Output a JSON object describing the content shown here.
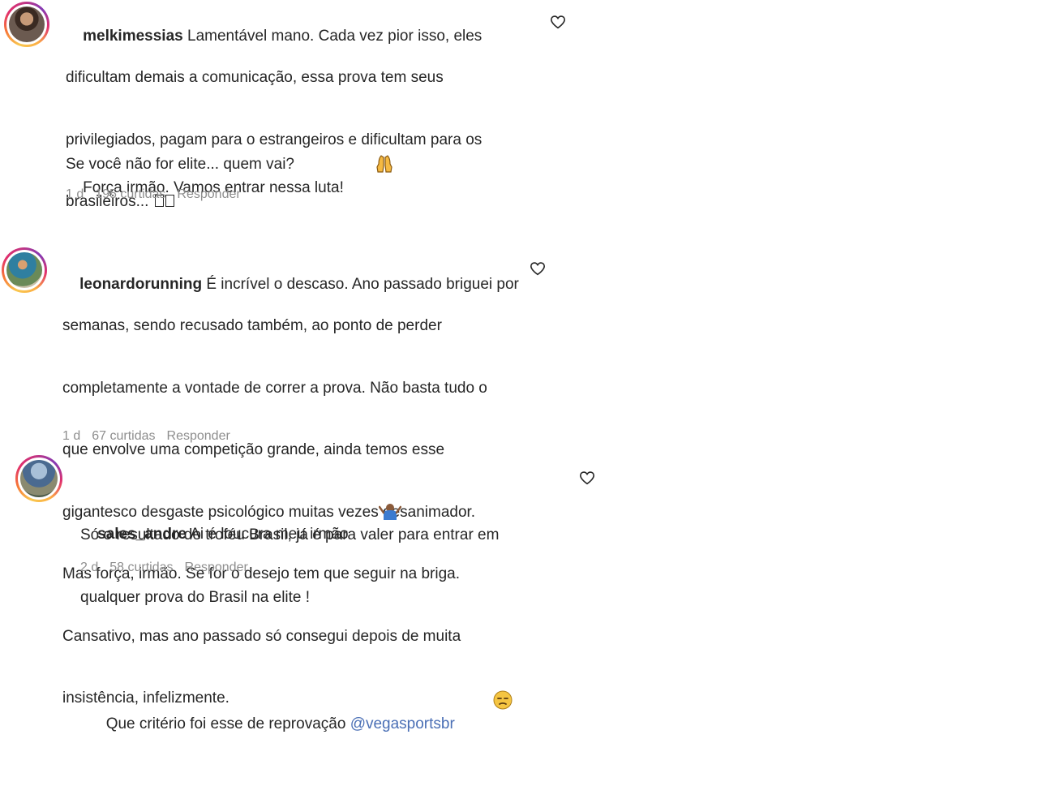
{
  "comments": [
    {
      "username": "melkimessias",
      "line1": "Lamentável mano. Cada vez pior isso, eles",
      "lines": [
        "dificultam demais a comunicação, essa prova tem seus",
        "privilegiados, pagam para o estrangeiros e dificultam para os",
        "brasileiros... "
      ],
      "para2": "Força irmão. Vamos entrar nessa luta! ",
      "para3": "Se você não for elite... quem vai?",
      "time": "1 d",
      "likes": "195 curtidas",
      "reply": "Responder"
    },
    {
      "username": "leonardorunning",
      "line1": "É incrível o descaso. Ano passado briguei por",
      "lines": [
        "semanas, sendo recusado também, ao ponto de perder",
        "completamente a vontade de correr a prova. Não basta tudo o",
        "que envolve uma competição grande, ainda temos esse",
        "gigantesco desgaste psicológico muitas vezes desanimador.",
        "Mas força, irmão. Se for o desejo tem que seguir na briga.",
        "Cansativo, mas ano passado só consegui depois de muita",
        "insistência, infelizmente."
      ],
      "time": "1 d",
      "likes": "67 curtidas",
      "reply": "Responder"
    },
    {
      "username": "sales_andre",
      "line1": "Ai é loucura meu irmão ",
      "lines": [
        "Só o resultado do troféu Brasil, já é para valer para entrar em",
        "qualquer prova do Brasil na elite !"
      ],
      "last_line_prefix": "Que critério foi esse de reprovação ",
      "mention": "@vegasportsbr",
      "time": "2 d",
      "likes": "58 curtidas",
      "reply": "Responder"
    }
  ],
  "icons": {
    "like": "heart-outline-icon",
    "emoji_pray": "pray-hands-emoji",
    "emoji_shrug": "woman-shrugging-emoji",
    "emoji_unamused": "pensive-face-emoji"
  }
}
